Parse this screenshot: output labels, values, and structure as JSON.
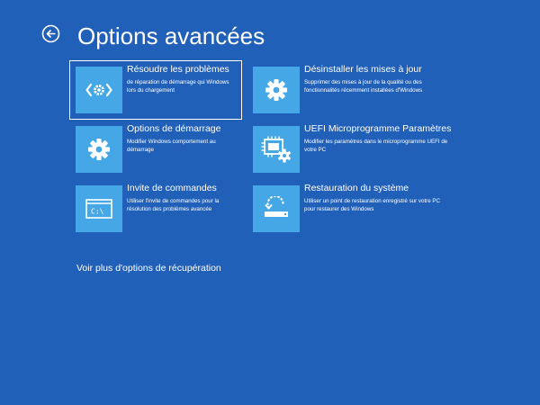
{
  "header": {
    "title": "Options avancées",
    "back_icon": "back-arrow-circle-icon"
  },
  "options": [
    {
      "title": "Résoudre les problèmes",
      "description": "de réparation de démarrage qui Windows lors du chargement",
      "icon": "wrench-code-icon",
      "selected": true
    },
    {
      "title": "Désinstaller les mises à jour",
      "description": "Supprimer des mises à jour de la qualité ou des fonctionnalités récemment installées d'Windows",
      "icon": "gear-icon",
      "selected": false
    },
    {
      "title": "Options de démarrage",
      "description": "Modifier Windows comportement au démarrage",
      "icon": "gear-icon",
      "selected": false
    },
    {
      "title": "UEFI  Microprogramme Paramètres",
      "description": "Modifier les paramètres dans le microprogramme UEFI de votre PC",
      "icon": "chip-gear-icon",
      "selected": false
    },
    {
      "title": "Invite de commandes",
      "description": "Utiliser l'invite de commandes pour la résolution des problèmes avancée",
      "icon": "command-prompt-icon",
      "selected": false
    },
    {
      "title": "Restauration du système",
      "description": "Utiliser un point de restauration enregistré sur votre PC pour restaurer des Windows",
      "icon": "system-restore-icon",
      "selected": false
    }
  ],
  "more_options_link": "Voir plus d'options de récupération",
  "colors": {
    "background": "#2160b8",
    "tile": "#46a7e6",
    "text": "#ffffff"
  }
}
